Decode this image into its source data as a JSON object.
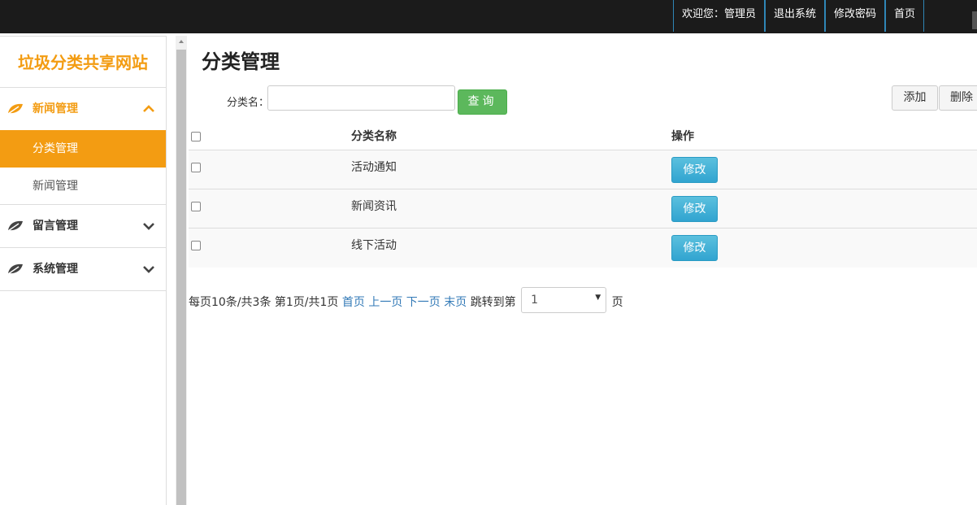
{
  "topbar": {
    "welcome": "欢迎您：管理员",
    "logout": "退出系统",
    "change_password": "修改密码",
    "home": "首页"
  },
  "sidebar": {
    "brand": "垃圾分类共享网站",
    "groups": [
      {
        "label": "新闻管理",
        "expanded": true,
        "icon": "leaf-icon",
        "items": [
          {
            "label": "分类管理",
            "active": true
          },
          {
            "label": "新闻管理",
            "active": false
          }
        ]
      },
      {
        "label": "留言管理",
        "expanded": false,
        "icon": "leaf-icon"
      },
      {
        "label": "系统管理",
        "expanded": false,
        "icon": "leaf-icon"
      }
    ]
  },
  "main": {
    "title": "分类管理",
    "search": {
      "label": "分类名：",
      "value": "",
      "button": "查询"
    },
    "actions": {
      "add": "添加",
      "delete": "删除"
    },
    "table": {
      "headers": [
        "分类名称",
        "操作"
      ],
      "rows": [
        {
          "name": "活动通知",
          "action": "修改"
        },
        {
          "name": "新闻资讯",
          "action": "修改"
        },
        {
          "name": "线下活动",
          "action": "修改"
        }
      ]
    },
    "pager": {
      "summary": "每页10条/共3条 第1页/共1页",
      "first": "首页",
      "prev": "上一页",
      "next": "下一页",
      "last": "末页",
      "jump_label": "跳转到第",
      "page_value": "1",
      "page_suffix": "页"
    }
  },
  "colors": {
    "accent": "#f39c12",
    "topbar": "#1b1b1b",
    "query_button": "#5cb85c",
    "edit_button": "#3daad8",
    "link": "#337ab7"
  }
}
